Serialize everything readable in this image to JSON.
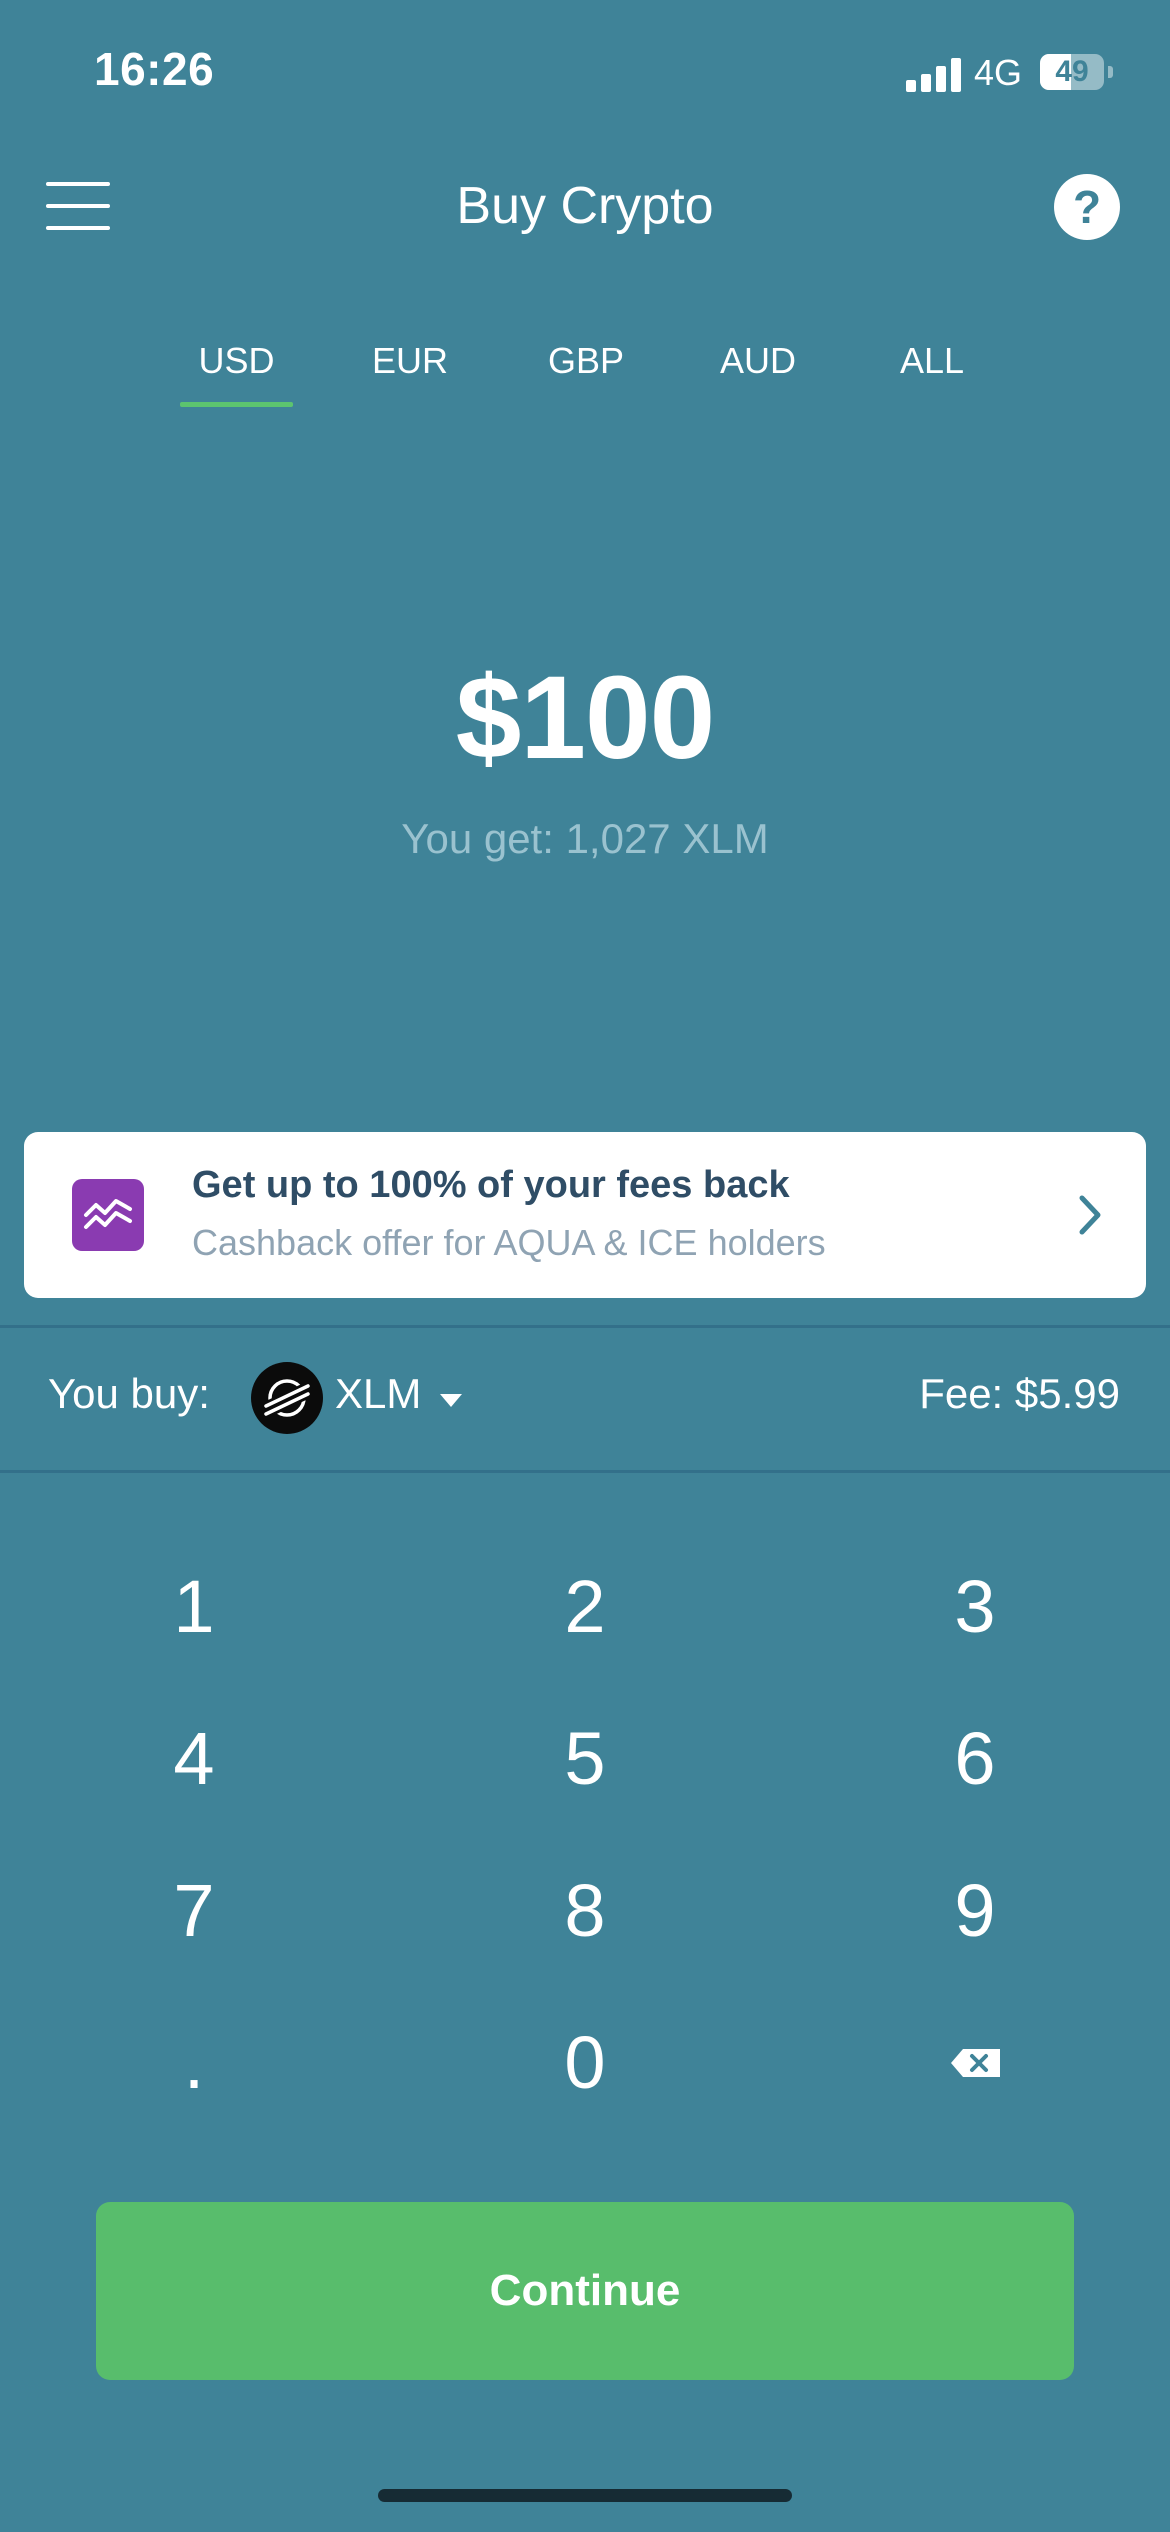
{
  "status_bar": {
    "time": "16:26",
    "network": "4G",
    "battery": "49"
  },
  "header": {
    "title": "Buy Crypto",
    "help_icon_text": "?"
  },
  "tabs": [
    {
      "label": "USD",
      "active": true
    },
    {
      "label": "EUR",
      "active": false
    },
    {
      "label": "GBP",
      "active": false
    },
    {
      "label": "AUD",
      "active": false
    },
    {
      "label": "ALL",
      "active": false
    }
  ],
  "amount": {
    "value": "$100",
    "you_get": "You get: 1,027 XLM"
  },
  "promo": {
    "title": "Get up to 100% of your fees back",
    "subtitle": "Cashback offer for AQUA & ICE holders",
    "icon": "chart-wave-icon"
  },
  "purchase": {
    "you_buy_label": "You buy:",
    "coin": "XLM",
    "coin_icon": "stellar-icon",
    "fee": "Fee: $5.99"
  },
  "keypad": {
    "keys": [
      "1",
      "2",
      "3",
      "4",
      "5",
      "6",
      "7",
      "8",
      "9",
      ".",
      "0",
      "backspace"
    ]
  },
  "continue_label": "Continue",
  "colors": {
    "background": "#3f8398",
    "accent": "#5cc46f",
    "button": "#58bd6c",
    "promo_icon": "#8a3bb1",
    "promo_title": "#2f4d66",
    "promo_subtitle": "#8fa3b3"
  }
}
